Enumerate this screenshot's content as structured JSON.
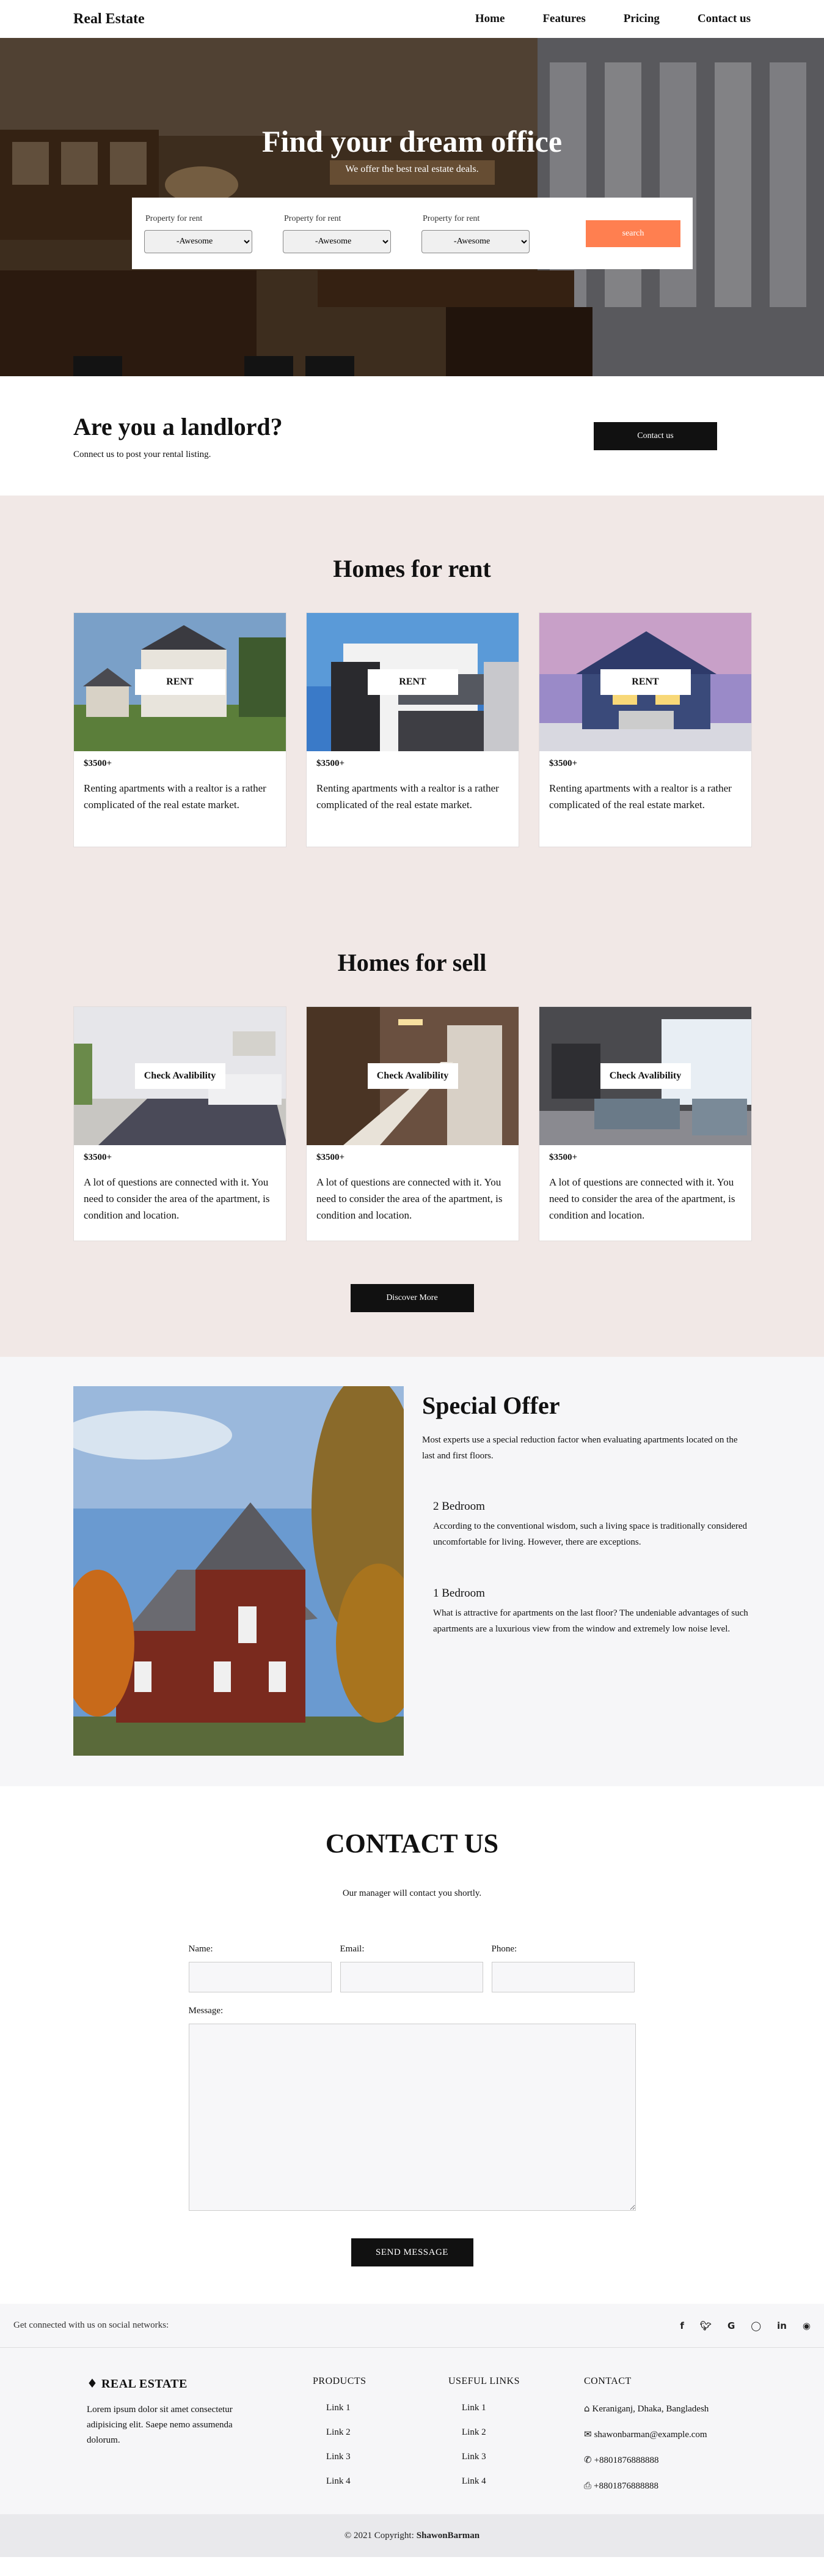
{
  "nav": {
    "brand": "Real Estate",
    "links": [
      "Home",
      "Features",
      "Pricing",
      "Contact us"
    ]
  },
  "hero": {
    "title": "Find your dream office",
    "subtitle": "We offer the best real estate deals.",
    "filters": [
      {
        "label": "Property for rent",
        "value": "-Awesome"
      },
      {
        "label": "Property for rent",
        "value": "-Awesome"
      },
      {
        "label": "Property for rent",
        "value": "-Awesome"
      }
    ],
    "search_label": "search"
  },
  "landlord": {
    "title": "Are you a landlord?",
    "text": "Connect us to post your rental listing.",
    "button": "Contact us"
  },
  "rent": {
    "title": "Homes for rent",
    "cards": [
      {
        "tag": "RENT",
        "price": "$3500+",
        "desc": "Renting apartments with a realtor is a rather complicated of the real estate market."
      },
      {
        "tag": "RENT",
        "price": "$3500+",
        "desc": "Renting apartments with a realtor is a rather complicated of the real estate market."
      },
      {
        "tag": "RENT",
        "price": "$3500+",
        "desc": "Renting apartments with a realtor is a rather complicated of the real estate market."
      }
    ]
  },
  "sell": {
    "title": "Homes for sell",
    "cards": [
      {
        "tag": "Check Avalibility",
        "price": "$3500+",
        "desc": "A lot of questions are connected with it. You need to consider the area of the apartment, is condition and location."
      },
      {
        "tag": "Check Avalibility",
        "price": "$3500+",
        "desc": "A lot of questions are connected with it. You need to consider the area of the apartment, is condition and location."
      },
      {
        "tag": "Check Avalibility",
        "price": "$3500+",
        "desc": "A lot of questions are connected with it. You need to consider the area of the apartment, is condition and location."
      }
    ],
    "button": "Discover More"
  },
  "special": {
    "title": "Special Offer",
    "lead": "Most experts use a special reduction factor when evaluating apartments located on the last and first floors.",
    "features": [
      {
        "title": "2 Bedroom",
        "text": "According to the conventional wisdom, such a living space is traditionally considered uncomfortable for living. However, there are exceptions."
      },
      {
        "title": "1 Bedroom",
        "text": "What is attractive for apartments on the last floor? The undeniable advantages of such apartments are a luxurious view from the window and extremely low noise level."
      }
    ]
  },
  "contact": {
    "title": "CONTACT US",
    "subtitle": "Our manager will contact you shortly.",
    "name_label": "Name:",
    "email_label": "Email:",
    "phone_label": "Phone:",
    "message_label": "Message:",
    "send": "SEND MESSAGE"
  },
  "social": {
    "text": "Get connected with us on social networks:",
    "icons": [
      "facebook-icon",
      "twitter-icon",
      "google-icon",
      "instagram-icon",
      "linkedin-icon",
      "github-icon"
    ]
  },
  "footer": {
    "brand": "REAL ESTATE",
    "about": "Lorem ipsum dolor sit amet consectetur adipisicing elit. Saepe nemo assumenda dolorum.",
    "products_title": "PRODUCTS",
    "products": [
      "Link 1",
      "Link 2",
      "Link 3",
      "Link 4"
    ],
    "useful_title": "USEFUL LINKS",
    "useful": [
      "Link 1",
      "Link 2",
      "Link 3",
      "Link 4"
    ],
    "contact_title": "CONTACT",
    "address": "Keraniganj, Dhaka, Bangladesh",
    "email": "shawonbarman@example.com",
    "phone": "+8801876888888",
    "fax": "+8801876888888",
    "copyright": "© 2021 Copyright:",
    "copyright_name": "ShawonBarman"
  },
  "colors": {
    "accent": "#ff7f50",
    "dark": "#111111",
    "homes_bg": "#f1e8e6",
    "light_bg": "#f6f6f8"
  }
}
